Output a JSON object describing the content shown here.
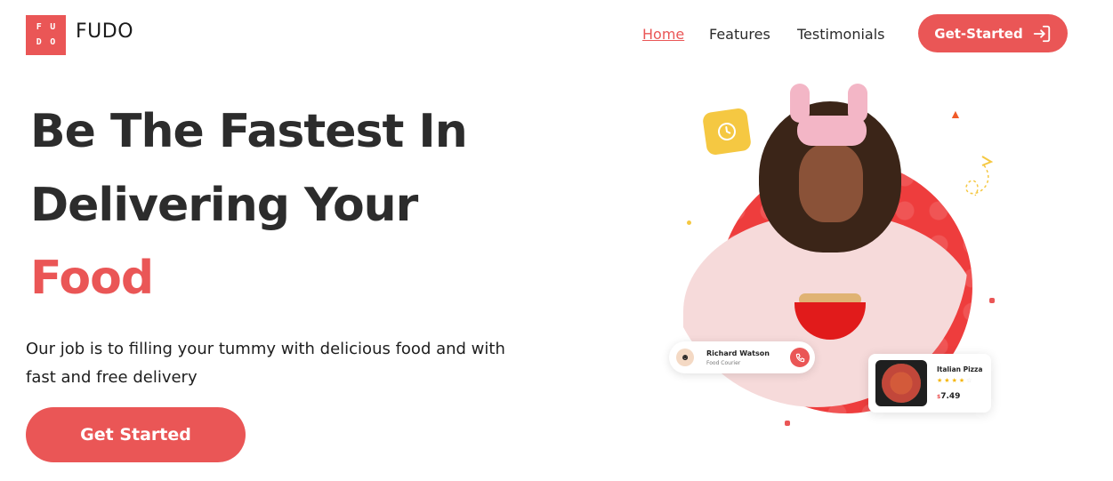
{
  "colors": {
    "accent": "#ea5656",
    "text": "#2c2c2c",
    "clock": "#f5c842",
    "circle": "#ee3d3d"
  },
  "header": {
    "logo_letters": [
      "F",
      "U",
      "D",
      "O"
    ],
    "brand": "FUDO",
    "nav": [
      "Home",
      "Features",
      "Testimonials"
    ],
    "active_nav": "Home",
    "cta_label": "Get-Started",
    "cta_icon": "login-arrow-icon"
  },
  "hero": {
    "title_line1": "Be The Fastest In",
    "title_line2": "Delivering Your",
    "title_line3": "Food",
    "subtitle": "Our job is to filling your tummy with delicious food and with fast and free delivery",
    "cta_label": "Get Started"
  },
  "illustration": {
    "icons": [
      "clock-icon",
      "flame-icon",
      "paper-plane-icon"
    ],
    "courier": {
      "name": "Richard Watson",
      "role": "Food Courier",
      "icon": "phone-icon"
    },
    "product": {
      "name": "Italian Pizza",
      "rating": 4,
      "currency": "$",
      "price": "7.49"
    }
  }
}
